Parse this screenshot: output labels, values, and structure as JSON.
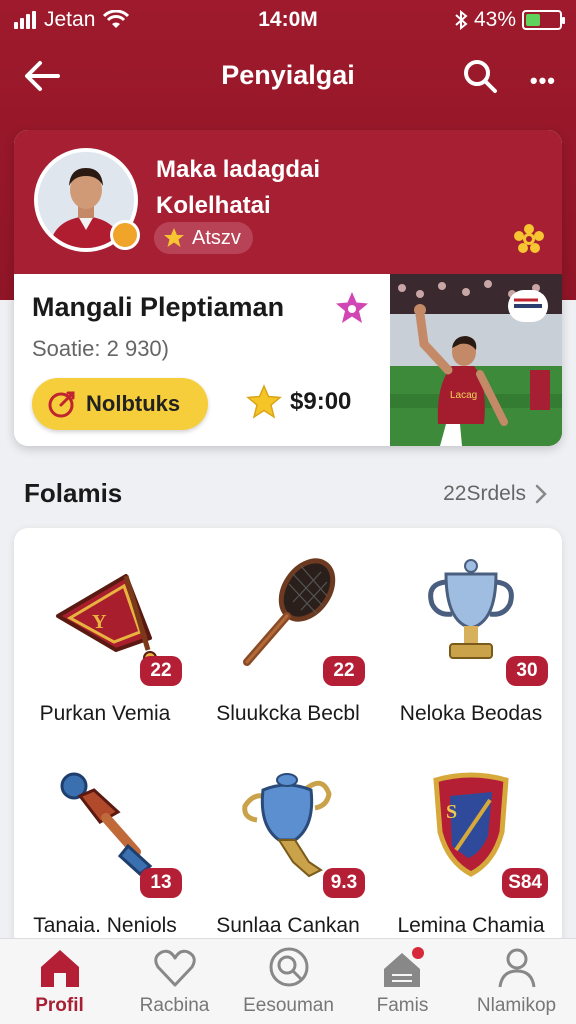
{
  "status_bar": {
    "carrier": "Jetan",
    "time": "14:0M",
    "battery": "43%",
    "battery_level": 0.43
  },
  "header": {
    "title": "Penyialgai"
  },
  "profile": {
    "name_line1": "Maka ladagdai",
    "name_line2": "Kolelhatai",
    "rank_label": "Atszv"
  },
  "featured": {
    "player_name": "Mangali Pleptiaman",
    "score": "Soatie: 2 930)",
    "button_label": "Nolbtuks",
    "price": "$9:00"
  },
  "section": {
    "title": "Folamis",
    "see_all": "22Srdels"
  },
  "items": [
    {
      "label": "Purkan Vemia",
      "count": "22",
      "icon": "banner-flag-icon"
    },
    {
      "label": "Sluukcka Becbl",
      "count": "22",
      "icon": "racket-icon"
    },
    {
      "label": "Neloka Beodas",
      "count": "30",
      "icon": "trophy-cup-icon"
    },
    {
      "label": "Tanaia. Neniols",
      "count": "13",
      "icon": "torch-trophy-icon"
    },
    {
      "label": "Sunlaa Cankan",
      "count": "9.3",
      "icon": "urn-trophy-icon"
    },
    {
      "label": "Lemina Chamia",
      "count": "S84",
      "icon": "shield-crest-icon"
    }
  ],
  "tabs": [
    {
      "label": "Profil",
      "icon": "home-icon",
      "active": true
    },
    {
      "label": "Racbina",
      "icon": "heart-icon",
      "active": false
    },
    {
      "label": "Eesouman",
      "icon": "search-icon",
      "active": false
    },
    {
      "label": "Famis",
      "icon": "house-notification-icon",
      "active": false
    },
    {
      "label": "Nlamikop",
      "icon": "person-icon",
      "active": false
    }
  ],
  "colors": {
    "brand": "#9e1a2c",
    "accent_yellow": "#f6ce3c",
    "badge": "#b41f36",
    "battery": "#5fd35b"
  }
}
